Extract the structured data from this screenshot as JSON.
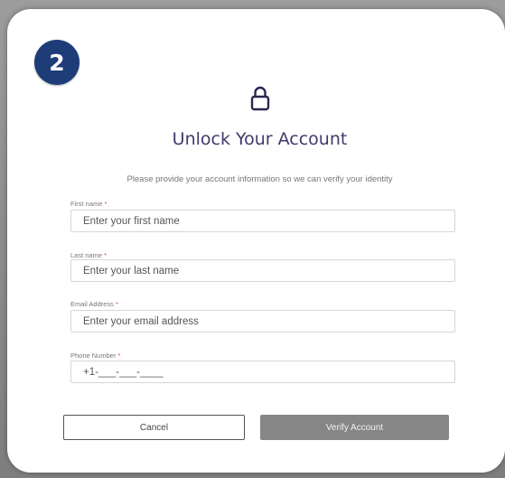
{
  "badge": {
    "number": "2"
  },
  "header": {
    "icon": "lock-icon",
    "title": "Unlock Your Account",
    "subtitle": "Please provide your account information so we can verify your identity"
  },
  "form": {
    "required_mark": "*",
    "fields": [
      {
        "label": "First name",
        "placeholder": "Enter your first name",
        "value": ""
      },
      {
        "label": "Last name",
        "placeholder": "Enter your last name",
        "value": ""
      },
      {
        "label": "Email Address",
        "placeholder": "Enter your email address",
        "value": ""
      },
      {
        "label": "Phone Number",
        "placeholder": "",
        "value": "+1-___-___-____"
      }
    ]
  },
  "buttons": {
    "cancel_label": "Cancel",
    "verify_label": "Verify Account"
  },
  "colors": {
    "badge": "#1d3c78",
    "title": "#3f3a6b",
    "required": "#d9534f",
    "verify_button": "#868686"
  }
}
